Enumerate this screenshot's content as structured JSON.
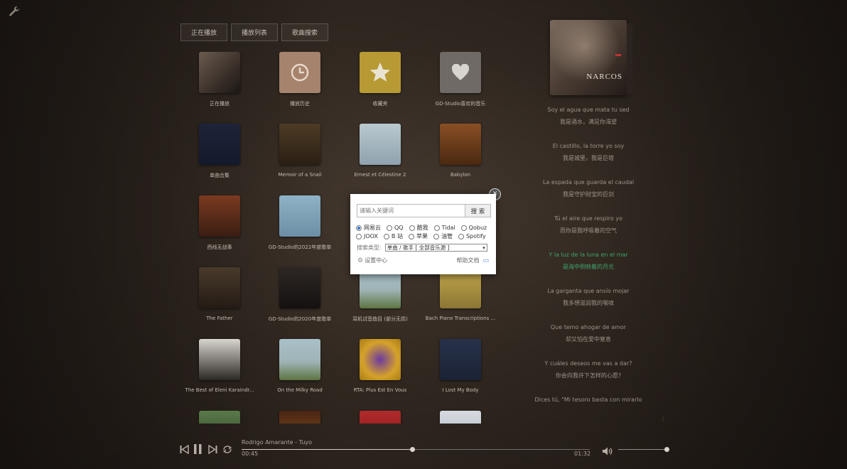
{
  "tabs": [
    "正在播放",
    "播放列表",
    "歌曲搜索"
  ],
  "grid": [
    {
      "label": "正在播放",
      "cover": "c-narcos",
      "icon": "narcos-cover"
    },
    {
      "label": "播放历史",
      "cover": "c-hist",
      "icon": "clock-icon"
    },
    {
      "label": "收藏夹",
      "cover": "c-fav",
      "icon": "star-icon"
    },
    {
      "label": "GD-Studio喜欢的音乐",
      "cover": "c-gd",
      "icon": "heart-icon"
    },
    {
      "label": "单曲合集",
      "cover": "c-ewf"
    },
    {
      "label": "Memoir of a Snail",
      "cover": "c-snail"
    },
    {
      "label": "Ernest et Célestine 2",
      "cover": "c-ernest"
    },
    {
      "label": "Babylon",
      "cover": "c-babylon"
    },
    {
      "label": "西线无战事",
      "cover": "c-ww2"
    },
    {
      "label": "GD-Studio的2022年度歌单",
      "cover": "c-gd22"
    },
    {
      "label": "",
      "cover": "c-milky"
    },
    {
      "label": "",
      "cover": "c-bach"
    },
    {
      "label": "The Father",
      "cover": "c-father"
    },
    {
      "label": "GD-Studio的2020年度歌单",
      "cover": "c-gd20"
    },
    {
      "label": "耳机试音曲目 (部分无损)",
      "cover": "c-milky"
    },
    {
      "label": "Bach Piano Transcriptions ...",
      "cover": "c-bach"
    },
    {
      "label": "The Best of Eleni Karaindr...",
      "cover": "c-eleni"
    },
    {
      "label": "On the Milky Road",
      "cover": "c-milky"
    },
    {
      "label": "RTA: Plus Est En Vous",
      "cover": "c-rita"
    },
    {
      "label": "I Lost My Body",
      "cover": "c-lost"
    },
    {
      "label": "",
      "cover": "c-r6a"
    },
    {
      "label": "",
      "cover": "c-r6b"
    },
    {
      "label": "",
      "cover": "c-r6c"
    },
    {
      "label": "",
      "cover": "c-r6d"
    }
  ],
  "player": {
    "track": "Rodrigo Amarante - Tuyo",
    "elapsed": "00:45",
    "duration": "01:32",
    "progress_fraction": 0.49,
    "volume_fraction": 1.0
  },
  "album_art": {
    "title": "NARCOS"
  },
  "lyrics": [
    {
      "o": "Soy el agua que mata tu sed",
      "t": "我是酒水，满足你渴望",
      "active": false
    },
    {
      "o": "El castillo, la torre yo soy",
      "t": "我是城堡，我是巨塔",
      "active": false
    },
    {
      "o": "La espada que guarda el caudal",
      "t": "我是守护财宝的巨剑",
      "active": false
    },
    {
      "o": "Tú el aire que respiro yo",
      "t": "而你是我呼吸着的空气",
      "active": false
    },
    {
      "o": "Y la luz de la luna en el mar",
      "t": "是海中倒映着的月光",
      "active": true
    },
    {
      "o": "La garganta que ansío mojar",
      "t": "我多想滋润我的喉咙",
      "active": false
    },
    {
      "o": "Que temo ahogar de amor",
      "t": "却又怕在爱中窒息",
      "active": false
    },
    {
      "o": "Y cuáles deseos me vas a dar?",
      "t": "你会向我许下怎样的心愿?",
      "active": false
    },
    {
      "o": "Dices tú, \"Mi tesoro basta con mirarlo",
      "t": "",
      "active": false
    }
  ],
  "dialog": {
    "placeholder": "请输入关键词",
    "search_label": "搜 索",
    "sources_row1": [
      {
        "name": "网易云",
        "selected": true
      },
      {
        "name": "QQ",
        "selected": false
      },
      {
        "name": "酷我",
        "selected": false
      },
      {
        "name": "Tidal",
        "selected": false
      },
      {
        "name": "Qobuz",
        "selected": false
      }
    ],
    "sources_row2": [
      {
        "name": "JOOX",
        "selected": false
      },
      {
        "name": "B 站",
        "selected": false
      },
      {
        "name": "苹果",
        "selected": false
      },
      {
        "name": "油管",
        "selected": false
      },
      {
        "name": "Spotify",
        "selected": false
      }
    ],
    "type_label": "搜索类型:",
    "type_value": "单曲 / 歌手 [ 全部音乐源 ]",
    "settings_label": "设置中心",
    "help_label": "帮助文档"
  },
  "colors": {
    "accent_lyric": "#3fa36a",
    "radio_selected": "#2a6fd6"
  }
}
